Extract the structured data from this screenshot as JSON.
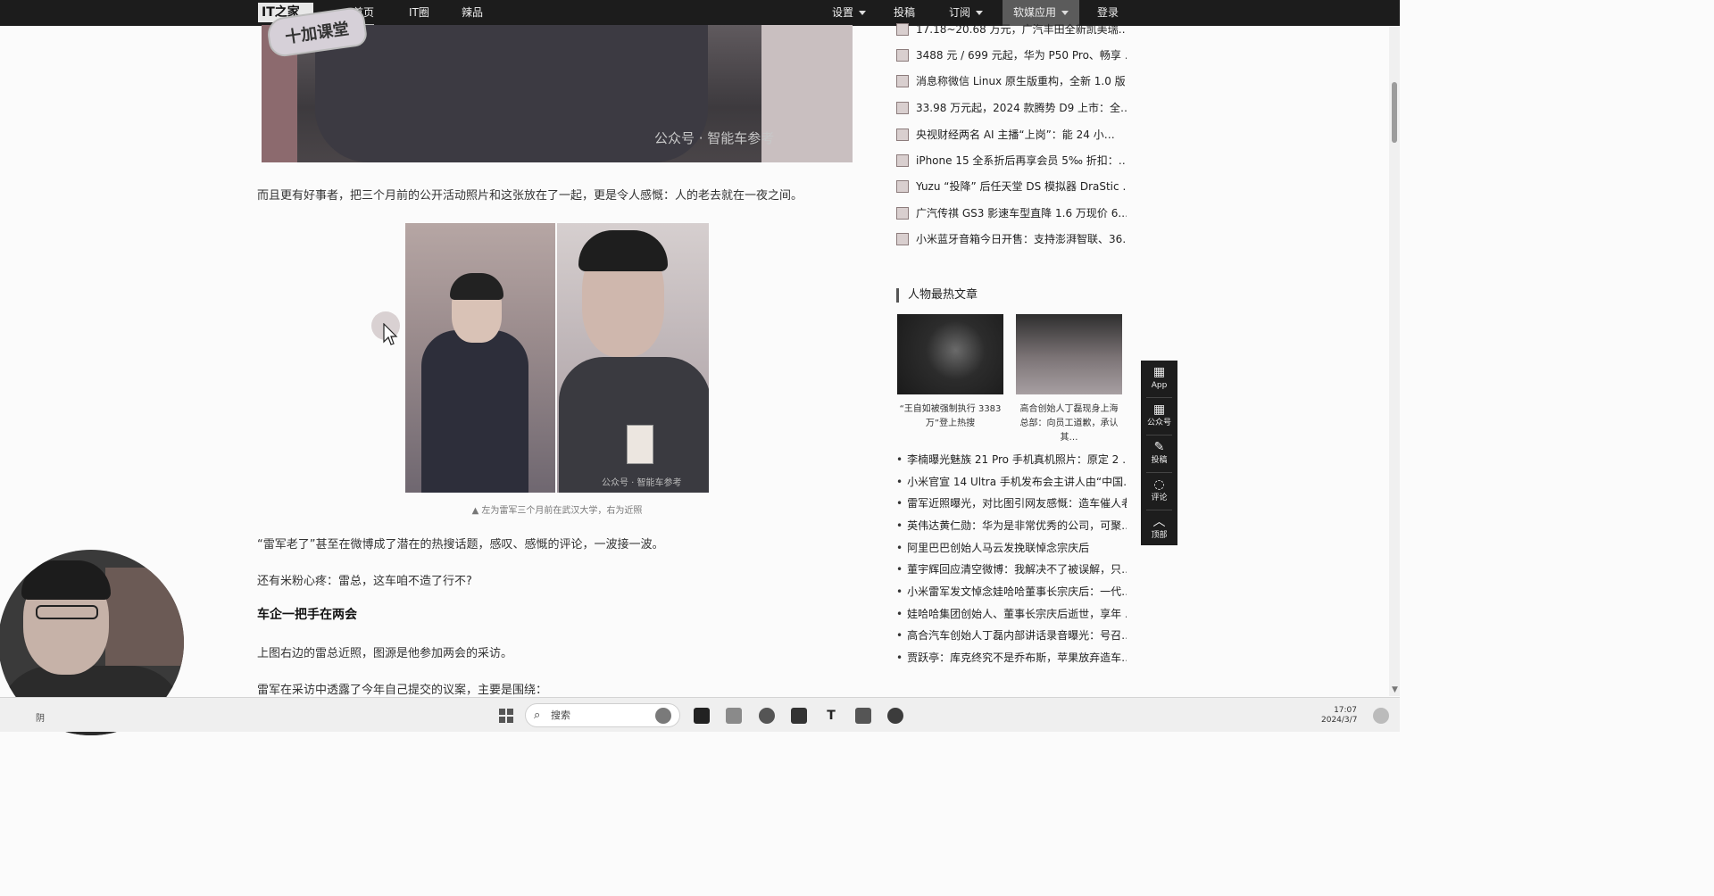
{
  "nav": {
    "logo": "IT之家",
    "items": [
      "首页",
      "IT圈",
      "辣品"
    ],
    "right_items": [
      "设置",
      "投稿",
      "订阅",
      "软媒应用",
      "登录"
    ]
  },
  "sticker_text": "十加课堂",
  "article": {
    "top_photo_watermark": "公众号 · 智能车参考",
    "para1": "而且更有好事者，把三个月前的公开活动照片和这张放在了一起，更是令人感慨：人的老去就在一夜之间。",
    "pair_watermark": "公众号 · 智能车参考",
    "caption": "▲ 左为雷军三个月前在武汉大学，右为近照",
    "para2": "“雷军老了”甚至在微博成了潜在的热搜话题，感叹、感慨的评论，一波接一波。",
    "para3": "还有米粉心疼：雷总，这车咱不造了行不?",
    "subhead": "车企一把手在两会",
    "para4": "上图右边的雷总近照，图源是他参加两会的采访。",
    "para5": "雷军在采访中透露了今年自己提交的议案，主要是围绕："
  },
  "sidebar": {
    "hot_items": [
      "17.18~20.68 万元，广汽丰田全新凯美瑞…",
      "3488 元 / 699 元起，华为 P50 Pro、畅享 …",
      "消息称微信 Linux 原生版重构，全新 1.0 版…",
      "33.98 万元起，2024 款腾势 D9 上市：全…",
      "央视财经两名 AI 主播“上岗”：能 24 小…",
      "iPhone 15 全系折后再享会员 5‰ 折扣：…",
      "Yuzu “投降” 后任天堂 DS 模拟器 DraStic …",
      "广汽传祺 GS3 影速车型直降 1.6 万现价 6.…",
      "小米蓝牙音箱今日开售：支持澎湃智联、36…"
    ],
    "section_title": "人物最热文章",
    "cards": [
      {
        "title": "“王自如被强制执行 3383 万”登上热搜"
      },
      {
        "title": "高合创始人丁磊现身上海总部：向员工道歉，承认其…"
      }
    ],
    "news_items": [
      "李楠曝光魅族 21 Pro 手机真机照片：原定 2 …",
      "小米官宣 14 Ultra 手机发布会主讲人由“中国…",
      "雷军近照曝光，对比图引网友感慨：造车催人老",
      "英伟达黄仁勋：华为是非常优秀的公司，可聚…",
      "阿里巴巴创始人马云发挽联悼念宗庆后",
      "董宇辉回应清空微博：我解决不了被误解，只…",
      "小米雷军发文悼念娃哈哈董事长宗庆后：一代…",
      "娃哈哈集团创始人、董事长宗庆后逝世，享年 …",
      "高合汽车创始人丁磊内部讲话录音曝光：号召…",
      "贾跃亭：库克终究不是乔布斯，苹果放弃造车…"
    ]
  },
  "float_bar": {
    "buttons": [
      {
        "label": "App",
        "icon": "qr-icon"
      },
      {
        "label": "公众号",
        "icon": "qr-icon"
      },
      {
        "label": "投稿",
        "icon": "edit-icon"
      },
      {
        "label": "评论",
        "icon": "comment-icon"
      },
      {
        "label": "顶部",
        "icon": "chevron-up-icon"
      }
    ]
  },
  "taskbar": {
    "search_placeholder": "搜索",
    "time": "17:07",
    "date": "2024/3/7",
    "weather_label": "阴"
  }
}
